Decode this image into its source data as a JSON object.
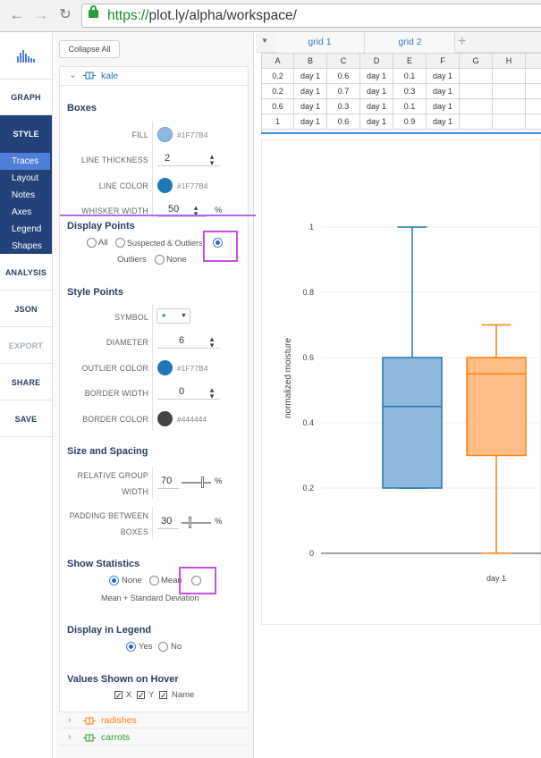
{
  "browser": {
    "back_icon": "left-arrow-icon",
    "forward_icon": "right-arrow-icon",
    "reload_icon": "reload-icon",
    "url_scheme": "https://",
    "url_rest": "plot.ly/alpha/workspace/"
  },
  "leftnav": {
    "logo_icon": "plotly-bars-icon",
    "items": [
      "GRAPH",
      "STYLE",
      "ANALYSIS",
      "JSON",
      "EXPORT",
      "SHARE",
      "SAVE"
    ],
    "sub_items": [
      "Traces",
      "Layout",
      "Notes",
      "Axes",
      "Legend",
      "Shapes"
    ]
  },
  "panel": {
    "collapse_all": "Collapse All",
    "traces": [
      {
        "name": "kale",
        "color": "#1F77B4"
      },
      {
        "name": "radishes",
        "color": "#ff7f0e"
      },
      {
        "name": "carrots",
        "color": "#2ca02c"
      }
    ],
    "boxes": {
      "title": "Boxes",
      "fill_label": "FILL",
      "fill_value": "#1F77B4",
      "fill_swatch": "#8fb8dd",
      "line_thickness_label": "LINE THICKNESS",
      "line_thickness_value": "2",
      "line_color_label": "LINE COLOR",
      "line_color_value": "#1F77B4",
      "line_color_swatch": "#1F77B4",
      "whisker_width_label": "WHISKER WIDTH",
      "whisker_width_value": "50",
      "whisker_unit": "%"
    },
    "display_points": {
      "title": "Display Points",
      "options": [
        "All",
        "Suspected & Outliers",
        "Outliers",
        "None"
      ],
      "selected": "Outliers"
    },
    "style_points": {
      "title": "Style Points",
      "symbol_label": "SYMBOL",
      "symbol_value": "•",
      "diameter_label": "DIAMETER",
      "diameter_value": "6",
      "outlier_color_label": "OUTLIER COLOR",
      "outlier_color_value": "#1F77B4",
      "outlier_color_swatch": "#1F77B4",
      "border_width_label": "BORDER WIDTH",
      "border_width_value": "0",
      "border_color_label": "BORDER COLOR",
      "border_color_value": "#444444",
      "border_color_swatch": "#444444"
    },
    "size_spacing": {
      "title": "Size and Spacing",
      "group_width_label_1": "RELATIVE GROUP",
      "group_width_label_2": "WIDTH",
      "group_width_value": "70",
      "group_width_level": 0.7,
      "padding_label_1": "PADDING BETWEEN",
      "padding_label_2": "BOXES",
      "padding_value": "30",
      "padding_level": 0.3,
      "unit": "%"
    },
    "show_statistics": {
      "title": "Show Statistics",
      "options": [
        "None",
        "Mean",
        "Mean + Standard Deviation"
      ],
      "selected": "None"
    },
    "display_legend": {
      "title": "Display in Legend",
      "options": [
        "Yes",
        "No"
      ],
      "selected": "Yes"
    },
    "hover_values": {
      "title": "Values Shown on Hover",
      "options": [
        "X",
        "Y",
        "Name"
      ],
      "checked": [
        true,
        true,
        true
      ]
    }
  },
  "grid": {
    "tabs": [
      "grid 1",
      "grid 2"
    ],
    "add_icon": "plus-icon",
    "dropdown_icon": "caret-down-icon",
    "columns": [
      "A",
      "B",
      "C",
      "D",
      "E",
      "F",
      "G",
      "H",
      ""
    ],
    "rows": [
      [
        "0.2",
        "day 1",
        "0.6",
        "day 1",
        "0.1",
        "day 1",
        "",
        "",
        ""
      ],
      [
        "0.2",
        "day 1",
        "0.7",
        "day 1",
        "0.3",
        "day 1",
        "",
        "",
        ""
      ],
      [
        "0.6",
        "day 1",
        "0.3",
        "day 1",
        "0.1",
        "day 1",
        "",
        "",
        ""
      ],
      [
        "1",
        "day 1",
        "0.6",
        "day 1",
        "0.9",
        "day 1",
        "",
        "",
        ""
      ]
    ]
  },
  "chart_data": {
    "type": "box",
    "ylabel": "normalized moisture",
    "xlabel": "",
    "categories": [
      "day 1"
    ],
    "ylim": [
      0,
      1
    ],
    "yticks": [
      "0",
      "0.2",
      "0.4",
      "0.6",
      "0.8",
      "1"
    ],
    "grid": true,
    "series": [
      {
        "color": "#1F77B4",
        "fill": "#8fb8dd",
        "min": 0.2,
        "q1": 0.2,
        "median": 0.45,
        "q3": 0.6,
        "max": 1
      },
      {
        "color": "#ff7f0e",
        "fill": "#ffbf87",
        "min": 0.0,
        "q1": 0.3,
        "median": 0.55,
        "q3": 0.6,
        "max": 0.7
      }
    ]
  }
}
